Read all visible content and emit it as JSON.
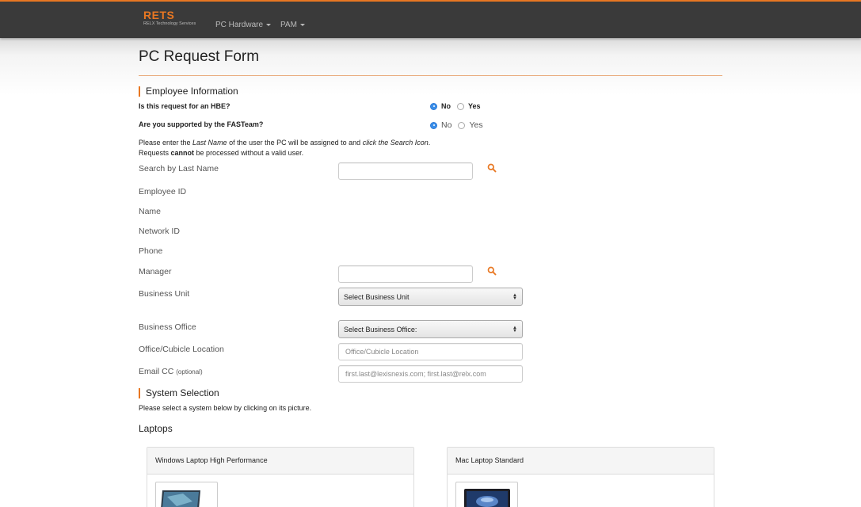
{
  "navbar": {
    "brand_name": "RETS",
    "brand_sub": "RELX Technology Services",
    "menu": [
      {
        "label": "PC Hardware"
      },
      {
        "label": "PAM"
      }
    ]
  },
  "page": {
    "title": "PC Request Form"
  },
  "employee": {
    "heading": "Employee Information",
    "q_hbe": {
      "label": "Is this request for an HBE?",
      "options": [
        "No",
        "Yes"
      ],
      "selected": "No"
    },
    "q_fas": {
      "label": "Are you supported by the FASTeam?",
      "options": [
        "No",
        "Yes"
      ],
      "selected": "No"
    },
    "instructions": {
      "part1": "Please enter the ",
      "em1": "Last Name",
      "part2": " of the user the PC will be assigned to and ",
      "em2": "click the Search Icon",
      "part3": ".",
      "line2_part1": "Requests ",
      "line2_bold": "cannot",
      "line2_part2": " be processed without a valid user."
    },
    "fields": {
      "search_last_name": {
        "label": "Search by Last Name",
        "value": "",
        "placeholder": ""
      },
      "employee_id": {
        "label": "Employee ID"
      },
      "name": {
        "label": "Name"
      },
      "network_id": {
        "label": "Network ID"
      },
      "phone": {
        "label": "Phone"
      },
      "manager": {
        "label": "Manager",
        "value": "",
        "placeholder": ""
      },
      "business_unit": {
        "label": "Business Unit",
        "selected": "Select Business Unit"
      },
      "business_office": {
        "label": "Business Office",
        "selected": "Select Business Office:"
      },
      "office_location": {
        "label": "Office/Cubicle Location",
        "placeholder": "Office/Cubicle Location"
      },
      "email_cc": {
        "label": "Email CC",
        "optional": "(optional)",
        "placeholder": "first.last@lexisnexis.com; first.last@relx.com"
      }
    }
  },
  "system": {
    "heading": "System Selection",
    "note": "Please select a system below by clicking on its picture.",
    "category": "Laptops",
    "cards": [
      {
        "title": "Windows Laptop High Performance"
      },
      {
        "title": "Mac Laptop Standard"
      }
    ]
  },
  "colors": {
    "accent": "#e87722",
    "navbar": "#3a3a3a",
    "radio_checked": "#3b8ee8"
  },
  "icons": {
    "search": "search-icon",
    "dropdown": "caret-down-icon"
  }
}
